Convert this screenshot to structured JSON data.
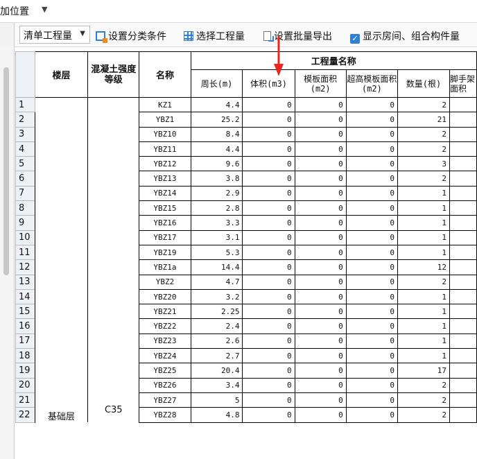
{
  "menu": {
    "label": "加位置",
    "caret": "▼"
  },
  "toolbar": {
    "combo_value": "清单工程量",
    "combo_caret": "▼",
    "set_category": "设置分类条件",
    "select_qty": "选择工程量",
    "batch_export": "设置批量导出",
    "show_rooms": "显示房间、组合构件量",
    "check_mark": "✓"
  },
  "table": {
    "headers": {
      "floor": "楼层",
      "grade": "混凝土强度等级",
      "name": "名称",
      "group": "工程量名称",
      "perimeter": "周长(m)",
      "volume": "体积(m3)",
      "formwork": "模板面积(m2)",
      "high_formwork": "超高模板面积(m2)",
      "count": "数量(根)",
      "scaffold": "脚手架面积"
    },
    "floor_value": "基础层",
    "grade_value": "C35",
    "rows": [
      {
        "n": "1",
        "name": "KZ1",
        "perimeter": "4.4",
        "volume": "0",
        "formwork": "0",
        "high": "0",
        "count": "2"
      },
      {
        "n": "2",
        "name": "YBZ1",
        "perimeter": "25.2",
        "volume": "0",
        "formwork": "0",
        "high": "0",
        "count": "21"
      },
      {
        "n": "3",
        "name": "YBZ10",
        "perimeter": "8.4",
        "volume": "0",
        "formwork": "0",
        "high": "0",
        "count": "2"
      },
      {
        "n": "4",
        "name": "YBZ11",
        "perimeter": "4.4",
        "volume": "0",
        "formwork": "0",
        "high": "0",
        "count": "2"
      },
      {
        "n": "5",
        "name": "YBZ12",
        "perimeter": "9.6",
        "volume": "0",
        "formwork": "0",
        "high": "0",
        "count": "3"
      },
      {
        "n": "6",
        "name": "YBZ13",
        "perimeter": "3.8",
        "volume": "0",
        "formwork": "0",
        "high": "0",
        "count": "2"
      },
      {
        "n": "7",
        "name": "YBZ14",
        "perimeter": "2.9",
        "volume": "0",
        "formwork": "0",
        "high": "0",
        "count": "1"
      },
      {
        "n": "8",
        "name": "YBZ15",
        "perimeter": "2.8",
        "volume": "0",
        "formwork": "0",
        "high": "0",
        "count": "1"
      },
      {
        "n": "9",
        "name": "YBZ16",
        "perimeter": "3.3",
        "volume": "0",
        "formwork": "0",
        "high": "0",
        "count": "1"
      },
      {
        "n": "10",
        "name": "YBZ17",
        "perimeter": "3.1",
        "volume": "0",
        "formwork": "0",
        "high": "0",
        "count": "1"
      },
      {
        "n": "11",
        "name": "YBZ19",
        "perimeter": "5.3",
        "volume": "0",
        "formwork": "0",
        "high": "0",
        "count": "1"
      },
      {
        "n": "12",
        "name": "YBZ1a",
        "perimeter": "14.4",
        "volume": "0",
        "formwork": "0",
        "high": "0",
        "count": "12"
      },
      {
        "n": "13",
        "name": "YBZ2",
        "perimeter": "4.7",
        "volume": "0",
        "formwork": "0",
        "high": "0",
        "count": "2"
      },
      {
        "n": "14",
        "name": "YBZ20",
        "perimeter": "3.2",
        "volume": "0",
        "formwork": "0",
        "high": "0",
        "count": "1"
      },
      {
        "n": "15",
        "name": "YBZ21",
        "perimeter": "2.25",
        "volume": "0",
        "formwork": "0",
        "high": "0",
        "count": "1"
      },
      {
        "n": "16",
        "name": "YBZ22",
        "perimeter": "2.4",
        "volume": "0",
        "formwork": "0",
        "high": "0",
        "count": "1"
      },
      {
        "n": "17",
        "name": "YBZ23",
        "perimeter": "2.6",
        "volume": "0",
        "formwork": "0",
        "high": "0",
        "count": "1"
      },
      {
        "n": "18",
        "name": "YBZ24",
        "perimeter": "2.7",
        "volume": "0",
        "formwork": "0",
        "high": "0",
        "count": "1"
      },
      {
        "n": "19",
        "name": "YBZ25",
        "perimeter": "20.4",
        "volume": "0",
        "formwork": "0",
        "high": "0",
        "count": "17"
      },
      {
        "n": "20",
        "name": "YBZ26",
        "perimeter": "3.4",
        "volume": "0",
        "formwork": "0",
        "high": "0",
        "count": "2"
      },
      {
        "n": "21",
        "name": "YBZ27",
        "perimeter": "5",
        "volume": "0",
        "formwork": "0",
        "high": "0",
        "count": "2"
      },
      {
        "n": "22",
        "name": "YBZ28",
        "perimeter": "4.8",
        "volume": "0",
        "formwork": "0",
        "high": "0",
        "count": "2"
      }
    ]
  },
  "colors": {
    "accent": "#2f7fd6",
    "arrow": "#e8271f",
    "header_bg": "#eef1f5"
  }
}
